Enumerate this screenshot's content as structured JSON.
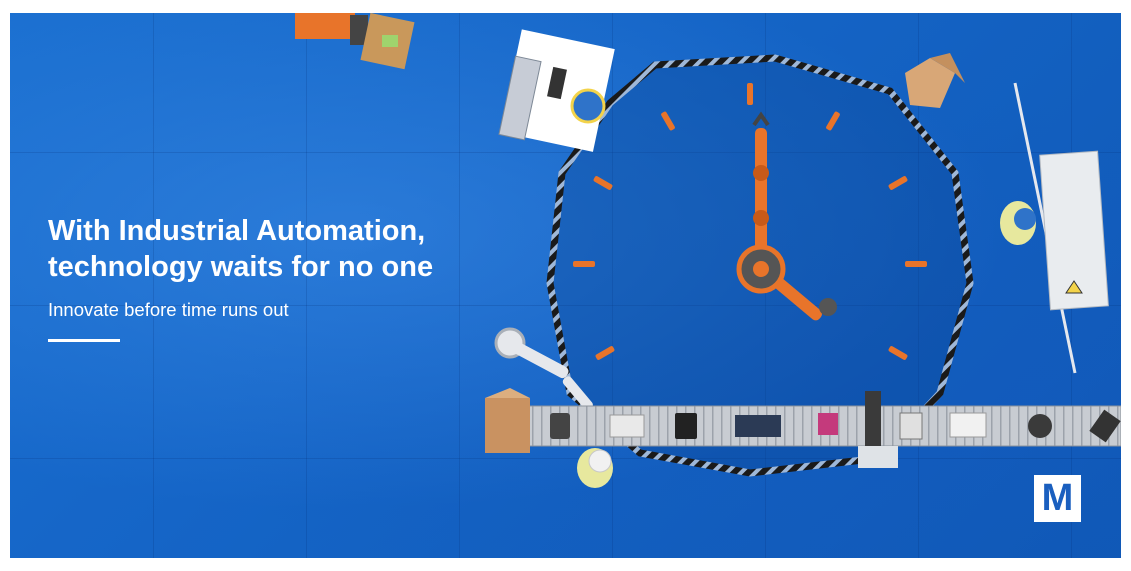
{
  "banner": {
    "headline_line1": "With Industrial Automation,",
    "headline_line2": "technology waits for no one",
    "subheadline": "Innovate before time runs out"
  },
  "logo": {
    "letter": "M"
  },
  "colors": {
    "background_blue": "#1565c7",
    "accent_orange": "#e8742a",
    "text": "#ffffff"
  }
}
